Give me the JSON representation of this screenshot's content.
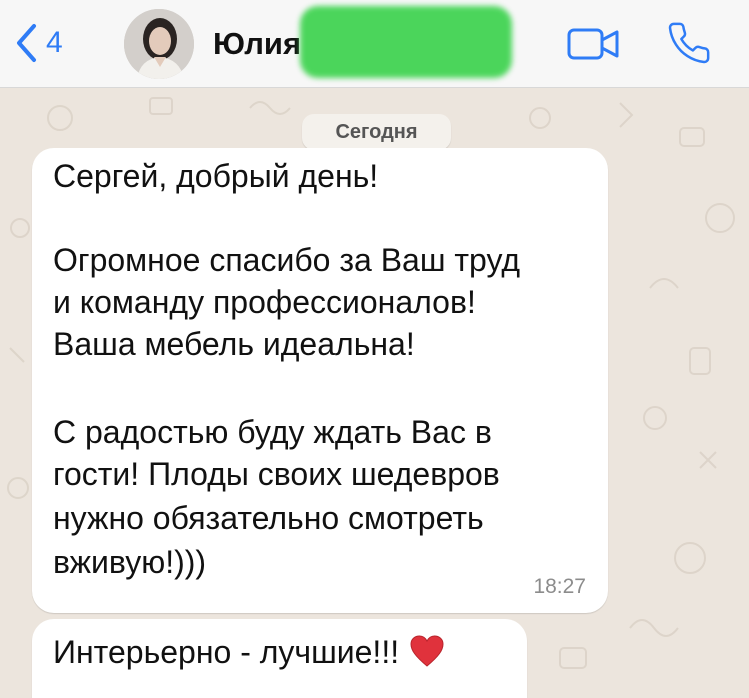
{
  "header": {
    "back_count": "4",
    "contact_name": "Юлия"
  },
  "chat": {
    "date_label": "Сегодня",
    "message1": {
      "lines": [
        "Сергей, добрый день!",
        "",
        "Огромное спасибо за Ваш труд",
        "и команду профессионалов!",
        "Ваша мебель идеальна!",
        "",
        "С радостью буду ждать Вас в",
        "гости! Плоды своих шедевров",
        "нужно обязательно смотреть",
        "вживую!)))"
      ],
      "time": "18:27"
    },
    "message2": {
      "text": "Интерьерно - лучшие!!!",
      "emoji": "red-heart"
    }
  },
  "colors": {
    "accent": "#2f7cf6",
    "redaction": "#3dd34e",
    "wallpaper": "#ece5dd",
    "bubble": "#ffffff"
  }
}
